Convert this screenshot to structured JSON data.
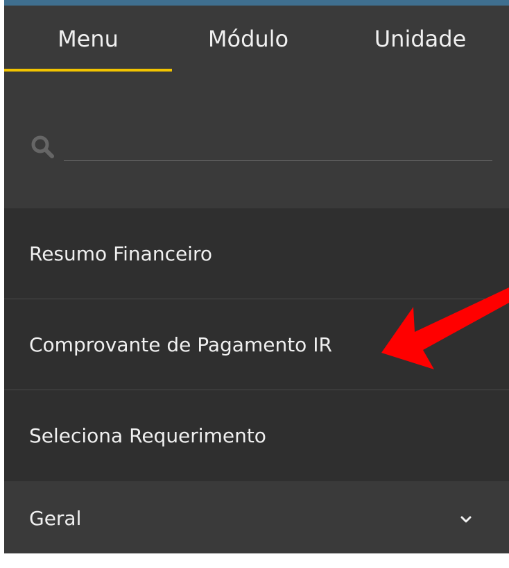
{
  "tabs": [
    {
      "label": "Menu",
      "active": true
    },
    {
      "label": "Módulo",
      "active": false
    },
    {
      "label": "Unidade",
      "active": false
    }
  ],
  "search": {
    "value": "",
    "placeholder": ""
  },
  "menu_items": [
    {
      "label": "Resumo Financeiro"
    },
    {
      "label": "Comprovante de Pagamento IR"
    },
    {
      "label": "Seleciona Requerimento"
    }
  ],
  "group": {
    "label": "Geral",
    "icon": "chevron-down-icon"
  },
  "colors": {
    "panel_bg": "#3a3a3a",
    "item_bg": "#2f2f2f",
    "accent_underline": "#f2c400",
    "arrow": "#ff0000",
    "text": "#f0f0f0"
  }
}
